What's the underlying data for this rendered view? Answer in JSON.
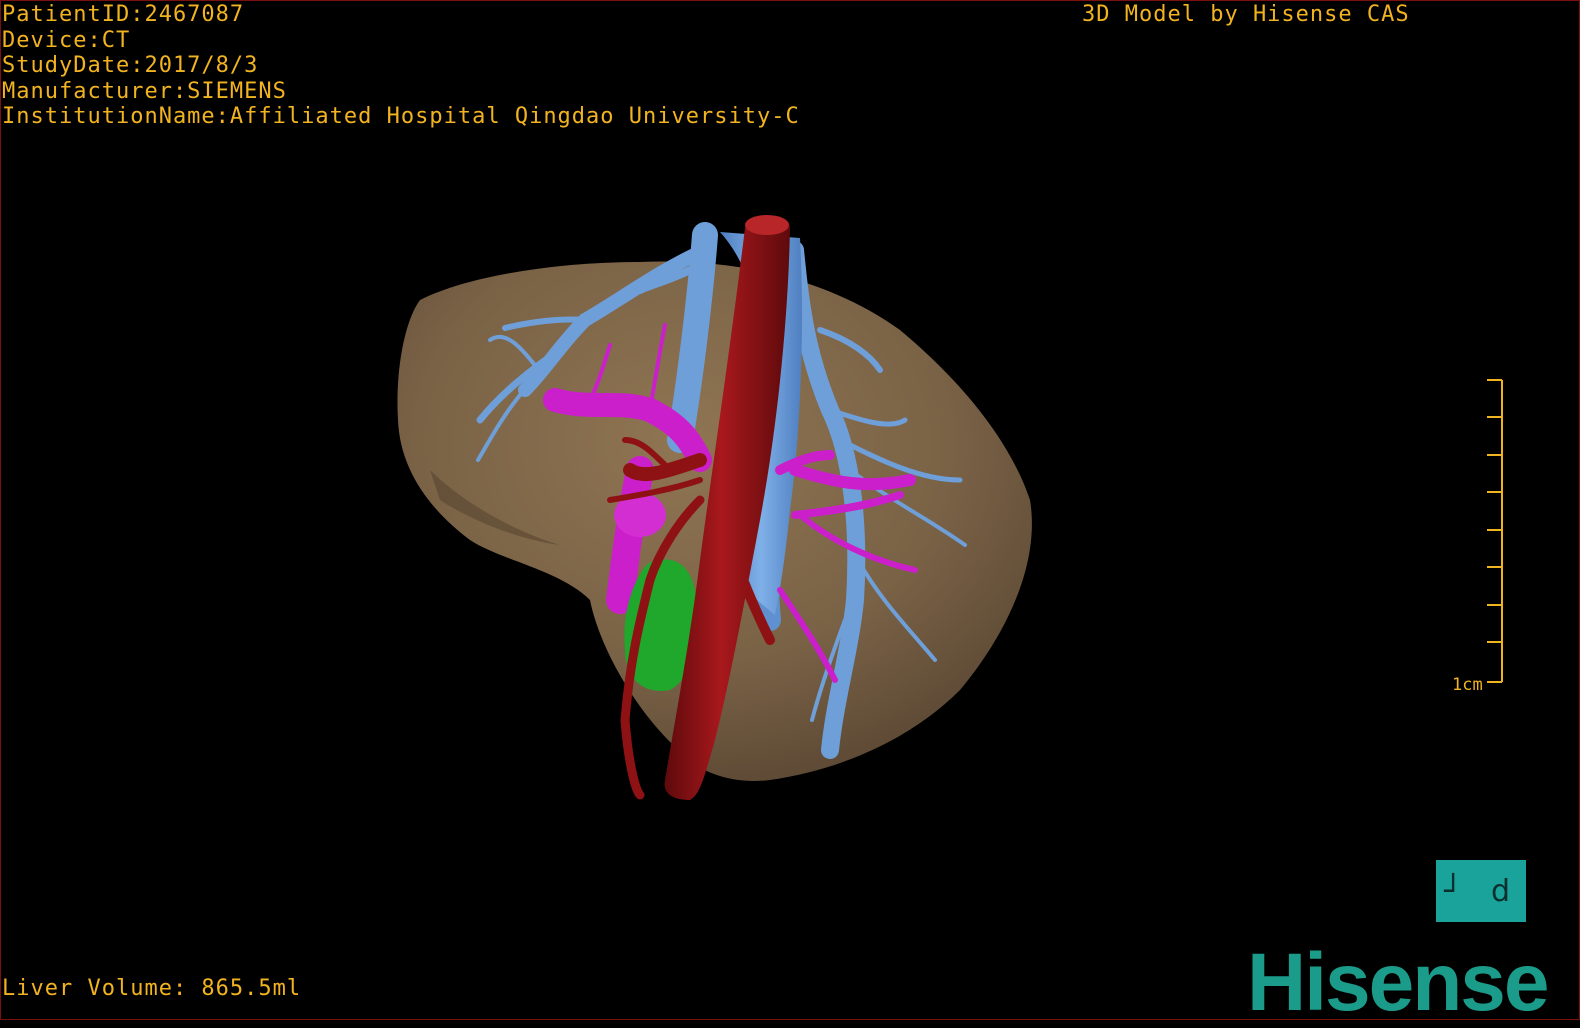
{
  "study_info": {
    "patient_id": "PatientID:2467087",
    "device": "Device:CT",
    "study_date": "StudyDate:2017/8/3",
    "manufacturer": "Manufacturer:SIEMENS",
    "institution": "InstitutionName:Affiliated Hospital Qingdao University-C"
  },
  "header_brand": "3D Model by Hisense CAS",
  "liver_volume": "Liver Volume: 865.5ml",
  "scale_bar": {
    "label": "1cm",
    "tick_count": 8
  },
  "orientation_cube": {
    "left_glyph": "┘",
    "right_glyph": "d"
  },
  "logo_text": "Hisense",
  "colors": {
    "overlay_text": "#f2b321",
    "liver": "#7a6246",
    "hepatic_vein": "#6f9fd8",
    "portal_vein": "#cc1fcc",
    "artery": "#8e1214",
    "gallbladder": "#1fa82c",
    "brand": "#1b9b8a"
  }
}
